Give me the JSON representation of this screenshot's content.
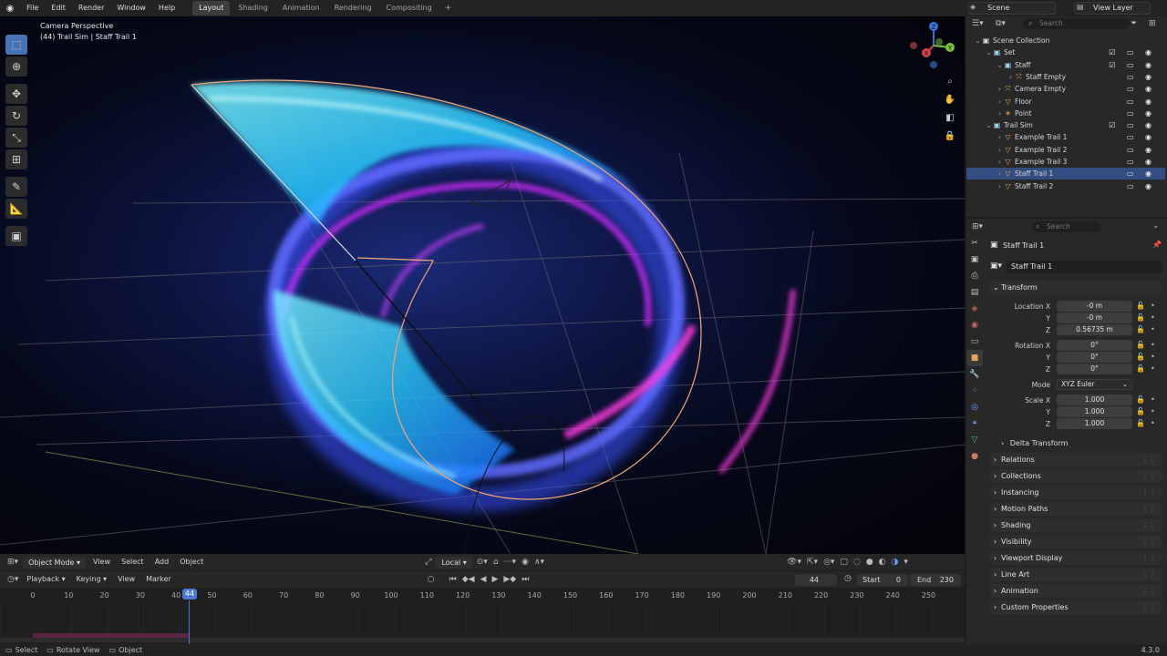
{
  "topbar": {
    "menus": [
      "File",
      "Edit",
      "Render",
      "Window",
      "Help"
    ],
    "workspaces": [
      "Layout",
      "Shading",
      "Animation",
      "Rendering",
      "Compositing"
    ],
    "active_workspace": "Layout",
    "add_label": "+",
    "scene": "Scene",
    "view_layer": "View Layer"
  },
  "viewport": {
    "title": "Camera Perspective",
    "subtitle": "(44) Trail Sim | Staff Trail 1",
    "gizmo": {
      "z": "Z",
      "y": "Y",
      "x": "X"
    }
  },
  "vp_header": {
    "mode": "Object Mode",
    "menus": [
      "View",
      "Select",
      "Add",
      "Object"
    ],
    "orientation": "Local"
  },
  "timeline": {
    "menus": [
      "Playback",
      "Keying",
      "View",
      "Marker"
    ],
    "current_frame": "44",
    "start_label": "Start",
    "start": "0",
    "end_label": "End",
    "end": "230",
    "ticks": [
      "0",
      "10",
      "20",
      "30",
      "40",
      "50",
      "60",
      "70",
      "80",
      "90",
      "100",
      "110",
      "120",
      "130",
      "140",
      "150",
      "160",
      "170",
      "180",
      "190",
      "200",
      "210",
      "220",
      "230",
      "240",
      "250"
    ]
  },
  "statusbar": {
    "items": [
      "Select",
      "Rotate View",
      "Object"
    ],
    "version": "4.3.0"
  },
  "outliner": {
    "search_placeholder": "Search",
    "rows": [
      {
        "label": "Scene Collection",
        "indent": 0,
        "icon": "collection"
      },
      {
        "label": "Set",
        "indent": 1,
        "icon": "collection"
      },
      {
        "label": "Staff",
        "indent": 2,
        "icon": "collection"
      },
      {
        "label": "Staff Empty",
        "indent": 3,
        "icon": "empty"
      },
      {
        "label": "Camera Empty",
        "indent": 2,
        "icon": "empty"
      },
      {
        "label": "Floor",
        "indent": 2,
        "icon": "mesh"
      },
      {
        "label": "Point",
        "indent": 2,
        "icon": "light"
      },
      {
        "label": "Trail Sim",
        "indent": 1,
        "icon": "collection"
      },
      {
        "label": "Example Trail 1",
        "indent": 2,
        "icon": "mesh"
      },
      {
        "label": "Example Trail 2",
        "indent": 2,
        "icon": "mesh"
      },
      {
        "label": "Example Trail 3",
        "indent": 2,
        "icon": "mesh"
      },
      {
        "label": "Staff Trail 1",
        "indent": 2,
        "icon": "mesh",
        "selected": true
      },
      {
        "label": "Staff Trail 2",
        "indent": 2,
        "icon": "mesh"
      }
    ]
  },
  "properties": {
    "search_placeholder": "Search",
    "object_name": "Staff Trail 1",
    "object_name_field": "Staff Trail 1",
    "transform_label": "Transform",
    "location_label": "Location X",
    "rotation_label": "Rotation X",
    "scale_label": "Scale X",
    "axis_y": "Y",
    "axis_z": "Z",
    "location": [
      "-0 m",
      "-0 m",
      "0.56735 m"
    ],
    "rotation": [
      "0°",
      "0°",
      "0°"
    ],
    "mode_label": "Mode",
    "mode": "XYZ Euler",
    "scale": [
      "1.000",
      "1.000",
      "1.000"
    ],
    "delta_transform": "Delta Transform",
    "panels": [
      "Relations",
      "Collections",
      "Instancing",
      "Motion Paths",
      "Shading",
      "Visibility",
      "Viewport Display",
      "Line Art",
      "Animation",
      "Custom Properties"
    ]
  }
}
